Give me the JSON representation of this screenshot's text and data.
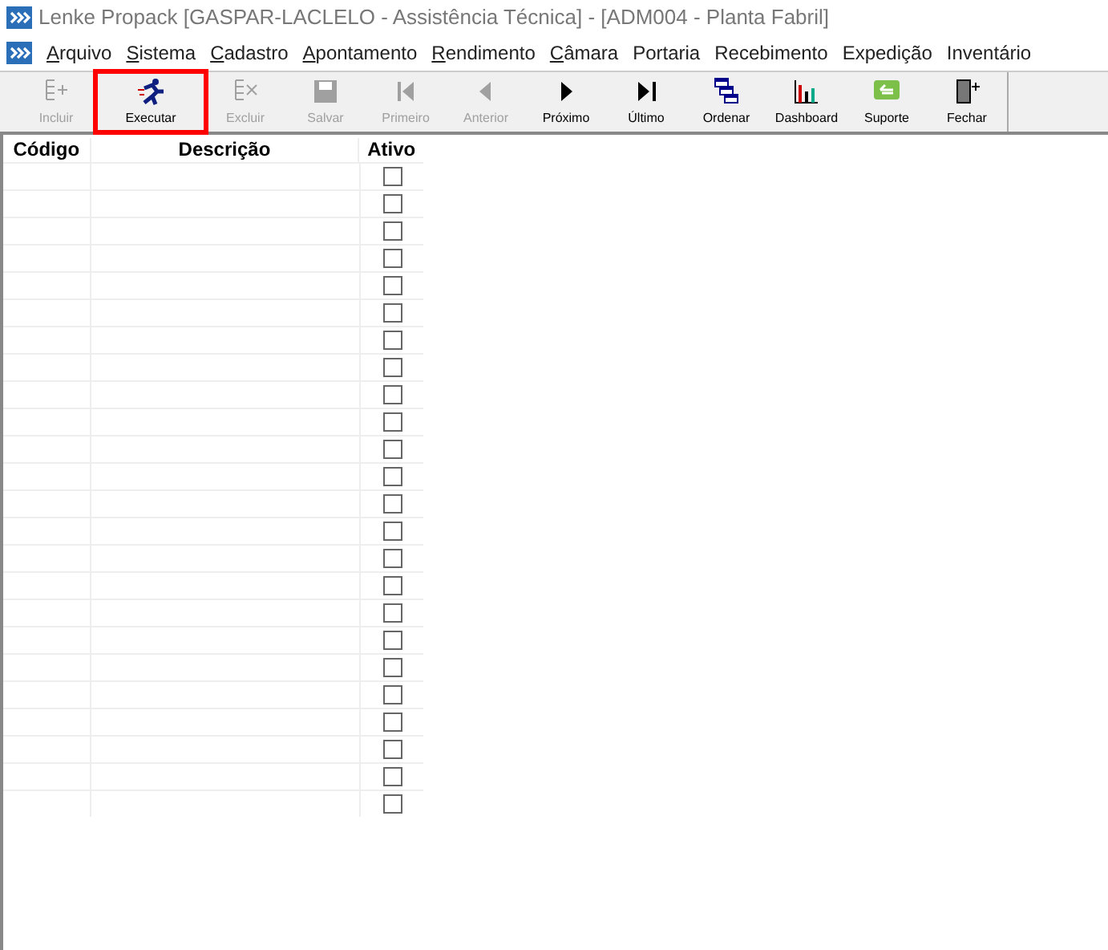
{
  "window": {
    "title": "Lenke Propack [GASPAR-LACLELO - Assistência Técnica] - [ADM004 - Planta Fabril]"
  },
  "menu": [
    {
      "label": "Arquivo",
      "mnemonic": true
    },
    {
      "label": "Sistema",
      "mnemonic": true
    },
    {
      "label": "Cadastro",
      "mnemonic": true
    },
    {
      "label": "Apontamento",
      "mnemonic": true
    },
    {
      "label": "Rendimento",
      "mnemonic": true
    },
    {
      "label": "Câmara",
      "mnemonic": true
    },
    {
      "label": "Portaria",
      "mnemonic": false
    },
    {
      "label": "Recebimento",
      "mnemonic": false
    },
    {
      "label": "Expedição",
      "mnemonic": false
    },
    {
      "label": "Inventário",
      "mnemonic": false
    }
  ],
  "toolbar": [
    {
      "label": "Incluir",
      "kind": "add",
      "disabled": true,
      "highlighted": false
    },
    {
      "label": "Executar",
      "kind": "run",
      "disabled": false,
      "highlighted": true
    },
    {
      "label": "Excluir",
      "kind": "delete",
      "disabled": true,
      "highlighted": false
    },
    {
      "label": "Salvar",
      "kind": "save",
      "disabled": true,
      "highlighted": false
    },
    {
      "label": "Primeiro",
      "kind": "first",
      "disabled": true,
      "highlighted": false
    },
    {
      "label": "Anterior",
      "kind": "prev",
      "disabled": true,
      "highlighted": false
    },
    {
      "label": "Próximo",
      "kind": "next",
      "disabled": false,
      "highlighted": false
    },
    {
      "label": "Último",
      "kind": "last",
      "disabled": false,
      "highlighted": false
    },
    {
      "label": "Ordenar",
      "kind": "sort",
      "disabled": false,
      "highlighted": false
    },
    {
      "label": "Dashboard",
      "kind": "chart",
      "disabled": false,
      "highlighted": false
    },
    {
      "label": "Suporte",
      "kind": "support",
      "disabled": false,
      "highlighted": false
    },
    {
      "label": "Fechar",
      "kind": "exit",
      "disabled": false,
      "highlighted": false
    }
  ],
  "table": {
    "columns": [
      "Código",
      "Descrição",
      "Ativo"
    ],
    "rows": [
      {
        "checked": false
      },
      {
        "checked": false
      },
      {
        "checked": false
      },
      {
        "checked": false
      },
      {
        "checked": false
      },
      {
        "checked": false
      },
      {
        "checked": false
      },
      {
        "checked": false
      },
      {
        "checked": false
      },
      {
        "checked": false
      },
      {
        "checked": false
      },
      {
        "checked": false
      },
      {
        "checked": false
      },
      {
        "checked": false
      },
      {
        "checked": false
      },
      {
        "checked": false
      },
      {
        "checked": false
      },
      {
        "checked": false
      },
      {
        "checked": false
      },
      {
        "checked": false
      },
      {
        "checked": false
      },
      {
        "checked": false
      },
      {
        "checked": false
      },
      {
        "checked": false
      }
    ]
  }
}
